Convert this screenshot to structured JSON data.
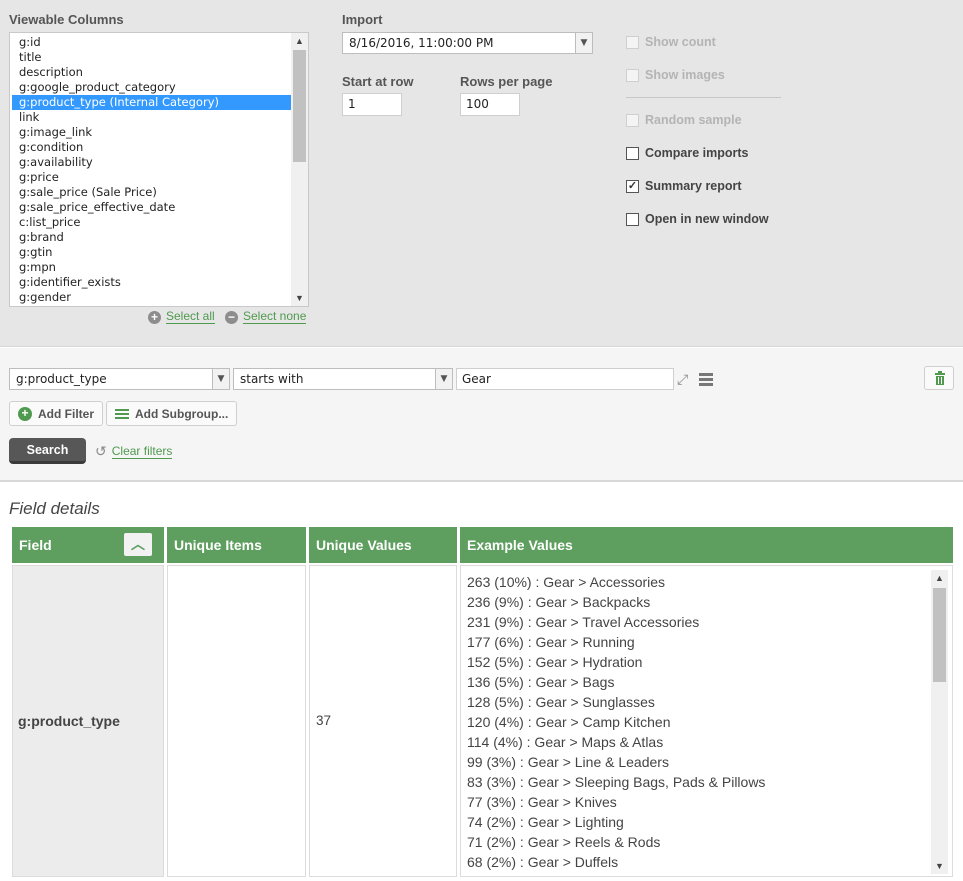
{
  "columns": {
    "label": "Viewable Columns",
    "items": [
      "g:id",
      "title",
      "description",
      "g:google_product_category",
      "g:product_type (Internal Category)",
      "link",
      "g:image_link",
      "g:condition",
      "g:availability",
      "g:price",
      "g:sale_price (Sale Price)",
      "g:sale_price_effective_date",
      "c:list_price",
      "g:brand",
      "g:gtin",
      "g:mpn",
      "g:identifier_exists",
      "g:gender"
    ],
    "selected": "g:product_type (Internal Category)",
    "select_all": "Select all",
    "select_none": "Select none"
  },
  "import": {
    "label": "Import",
    "value": "8/16/2016, 11:00:00 PM",
    "start_row_label": "Start at row",
    "start_row_value": "1",
    "rows_per_page_label": "Rows per page",
    "rows_per_page_value": "100"
  },
  "options": {
    "show_count": "Show count",
    "show_images": "Show images",
    "random_sample": "Random sample",
    "compare_imports": "Compare imports",
    "summary_report": "Summary report",
    "open_new_window": "Open in new window",
    "summary_report_checked": "✓"
  },
  "filter": {
    "field": "g:product_type",
    "operator": "starts with",
    "value": "Gear",
    "add_filter": "Add Filter",
    "add_subgroup": "Add Subgroup...",
    "search": "Search",
    "clear_filters": "Clear filters"
  },
  "details": {
    "title": "Field details",
    "headers": [
      "Field",
      "Unique Items",
      "Unique Values",
      "Example Values"
    ],
    "field": "g:product_type",
    "unique_items": "",
    "unique_values": "37",
    "examples": [
      "263 (10%) : Gear > Accessories",
      "236 (9%) : Gear > Backpacks",
      "231 (9%) : Gear > Travel Accessories",
      "177 (6%) : Gear > Running",
      "152 (5%) : Gear > Hydration",
      "136 (5%) : Gear > Bags",
      "128 (5%) : Gear > Sunglasses",
      "120 (4%) : Gear > Camp Kitchen",
      "114 (4%) : Gear > Maps & Atlas",
      "99 (3%) : Gear > Line & Leaders",
      "83 (3%) : Gear > Sleeping Bags, Pads & Pillows",
      "77 (3%) : Gear > Knives",
      "74 (2%) : Gear > Lighting",
      "71 (2%) : Gear > Reels & Rods",
      "68 (2%) : Gear > Duffels"
    ]
  },
  "colors": {
    "accent_green": "#5e9e5e",
    "selection_blue": "#3399ff"
  }
}
